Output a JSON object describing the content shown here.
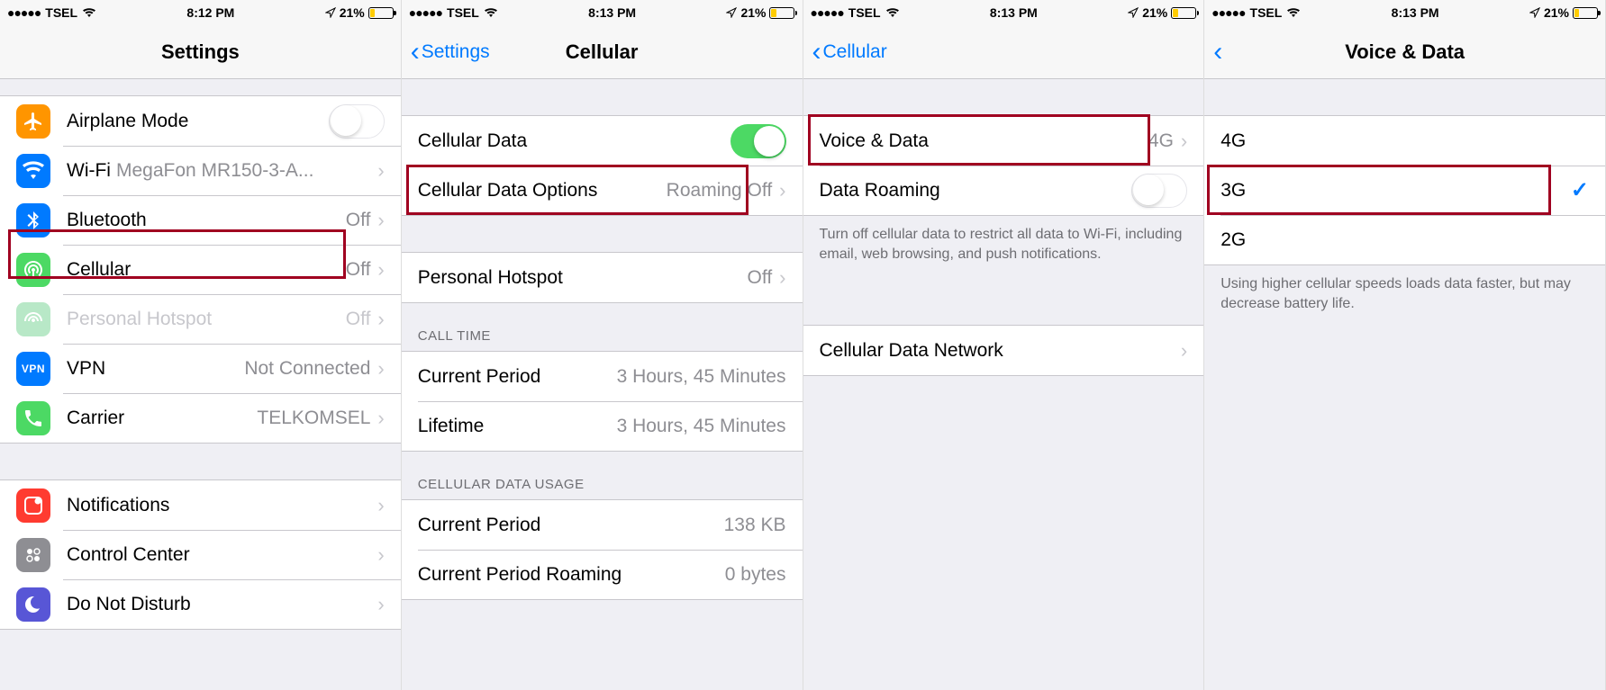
{
  "status": {
    "carrier": "TSEL",
    "time1": "8:12 PM",
    "time2": "8:13 PM",
    "battery_pct": "21%"
  },
  "screen1": {
    "title": "Settings",
    "rows": {
      "airplane": "Airplane Mode",
      "wifi": "Wi-Fi",
      "wifi_val": "MegaFon MR150-3-A...",
      "bluetooth": "Bluetooth",
      "bluetooth_val": "Off",
      "cellular": "Cellular",
      "cellular_val": "Off",
      "hotspot": "Personal Hotspot",
      "hotspot_val": "Off",
      "vpn": "VPN",
      "vpn_val": "Not Connected",
      "carrier": "Carrier",
      "carrier_val": "TELKOMSEL",
      "notifications": "Notifications",
      "control_center": "Control Center",
      "dnd": "Do Not Disturb"
    }
  },
  "screen2": {
    "back": "Settings",
    "title": "Cellular",
    "rows": {
      "cellular_data": "Cellular Data",
      "options": "Cellular Data Options",
      "options_val": "Roaming Off",
      "hotspot": "Personal Hotspot",
      "hotspot_val": "Off"
    },
    "call_time_header": "CALL TIME",
    "call_time": {
      "current": "Current Period",
      "current_val": "3 Hours, 45 Minutes",
      "lifetime": "Lifetime",
      "lifetime_val": "3 Hours, 45 Minutes"
    },
    "usage_header": "CELLULAR DATA USAGE",
    "usage": {
      "current": "Current Period",
      "current_val": "138 KB",
      "roaming": "Current Period Roaming",
      "roaming_val": "0 bytes"
    }
  },
  "screen3": {
    "back": "Cellular",
    "rows": {
      "voice_data": "Voice & Data",
      "voice_data_val": "4G",
      "roaming": "Data Roaming"
    },
    "footer": "Turn off cellular data to restrict all data to Wi-Fi, including email, web browsing, and push notifications.",
    "network": "Cellular Data Network"
  },
  "screen4": {
    "title": "Voice & Data",
    "options": {
      "o4g": "4G",
      "o3g": "3G",
      "o2g": "2G"
    },
    "footer": "Using higher cellular speeds loads data faster, but may decrease battery life."
  }
}
